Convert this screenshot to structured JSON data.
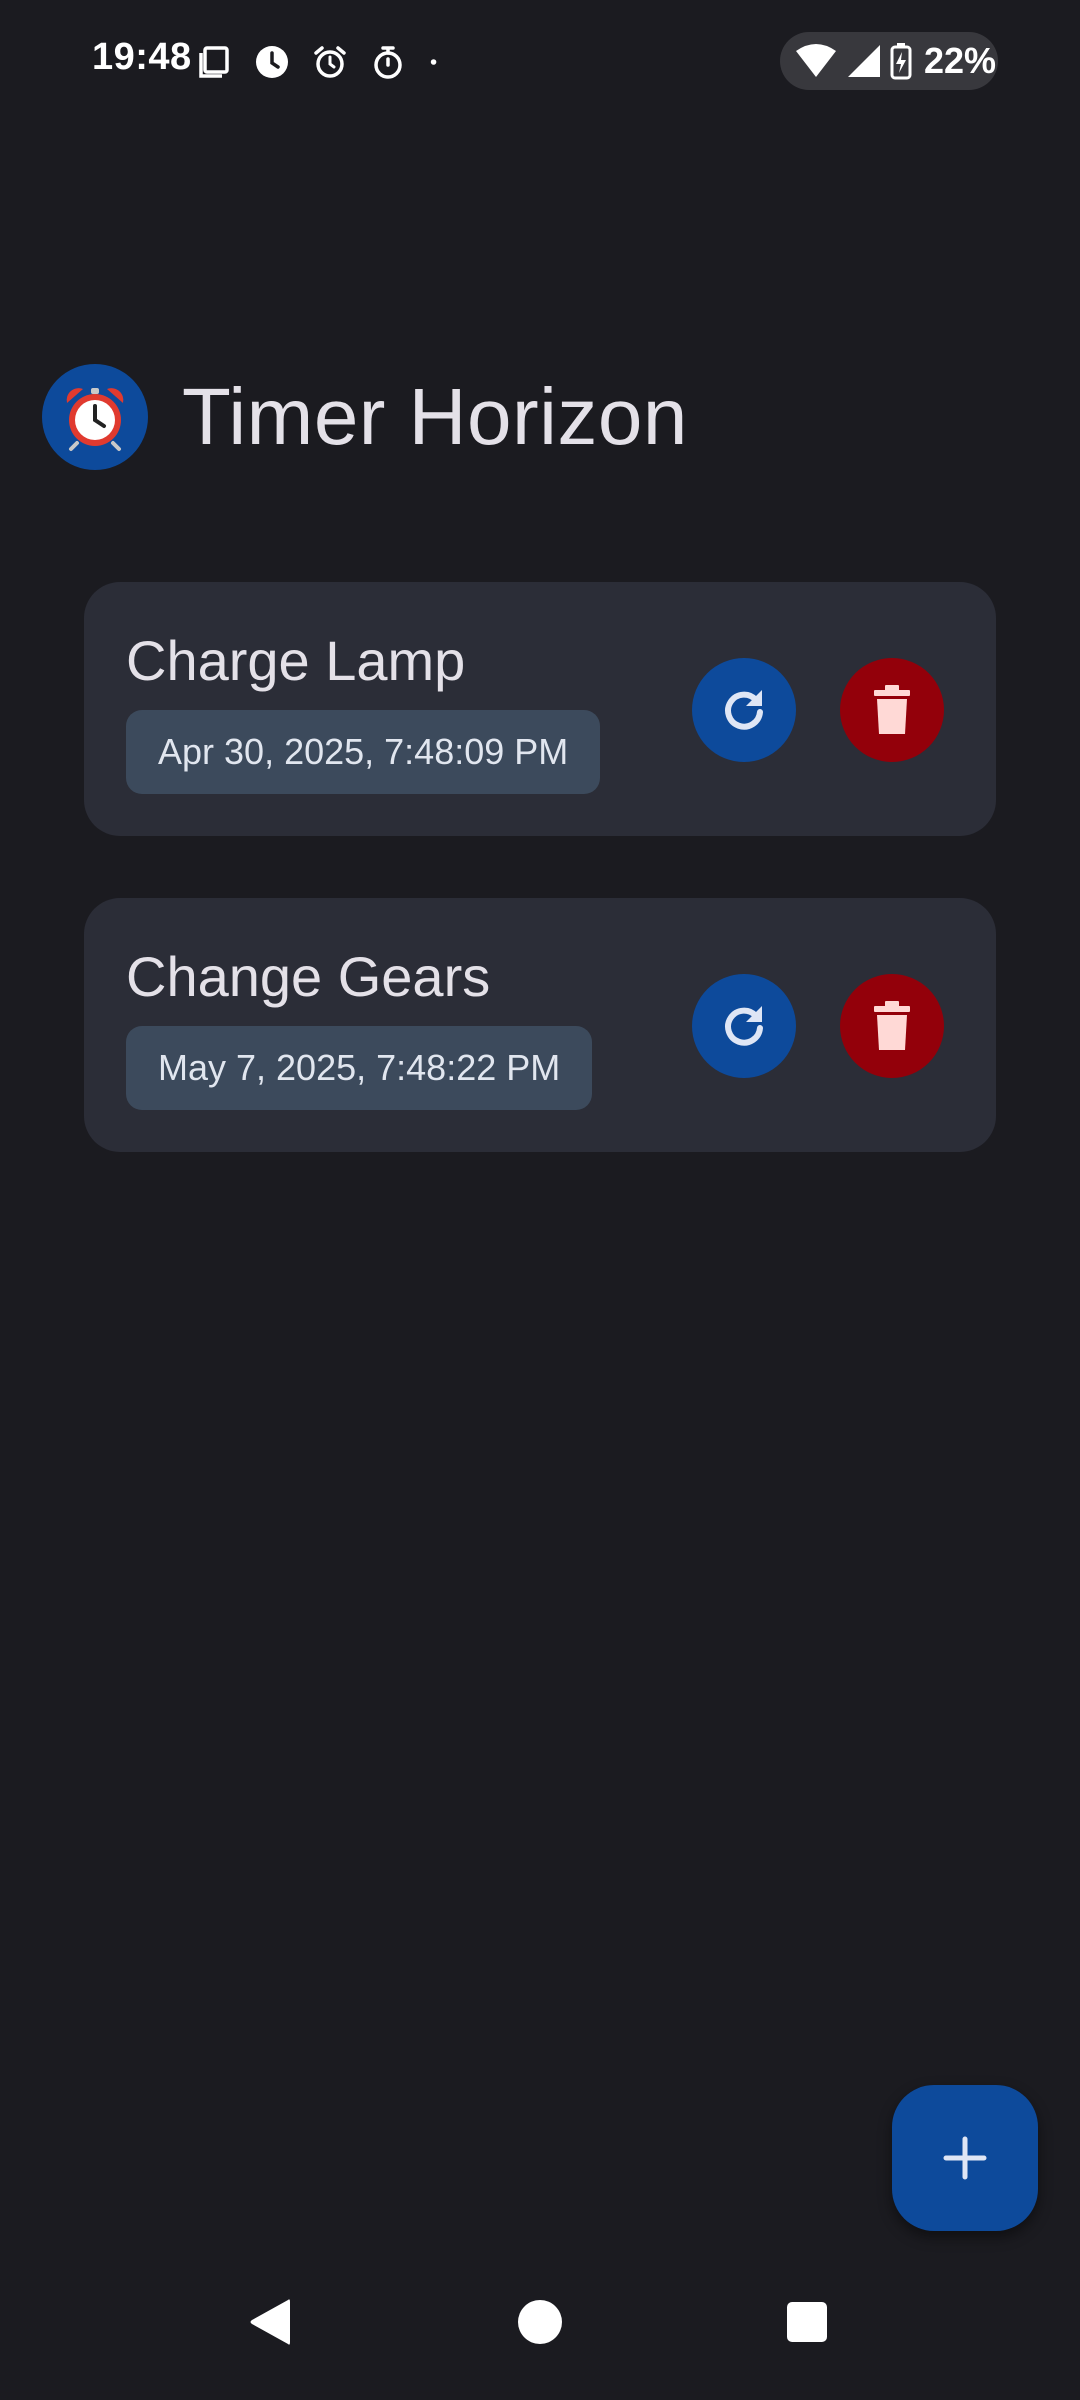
{
  "status_bar": {
    "time": "19:48",
    "battery": "22%"
  },
  "header": {
    "title": "Timer Horizon",
    "logo_icon": "alarm-clock-icon"
  },
  "timers": [
    {
      "name": "Charge Lamp",
      "date": "Apr 30, 2025, 7:48:09 PM"
    },
    {
      "name": "Change Gears",
      "date": "May 7, 2025, 7:48:22 PM"
    }
  ],
  "colors": {
    "background": "#1b1b20",
    "card": "#2b2d37",
    "date_chip": "#3c4a5c",
    "primary": "#0d4a9b",
    "danger": "#93000a"
  },
  "icons": {
    "reset": "refresh-icon",
    "delete": "trash-icon",
    "add": "plus-icon"
  }
}
